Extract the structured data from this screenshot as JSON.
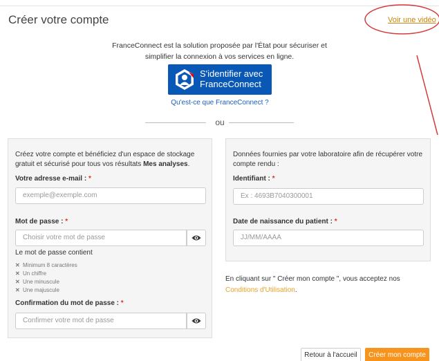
{
  "header": {
    "title": "Créer votre compte",
    "video_link": "Voir une vidéo"
  },
  "franceconnect": {
    "intro_line1": "FranceConnect est la solution proposée par l'État pour sécuriser et",
    "intro_line2": "simplifier la connexion à vos services en ligne.",
    "button_line1": "S'identifier avec",
    "button_line2": "FranceConnect",
    "what_link": "Qu'est-ce que FranceConnect ?",
    "brand_color": "#0a58b5"
  },
  "separator": {
    "text": "ou"
  },
  "account_form": {
    "intro_prefix": "Créez votre compte et bénéficiez d'un espace de stockage gratuit et sécurisé pour tous vos résultats ",
    "intro_bold": "Mes analyses",
    "intro_suffix": ".",
    "email_label": "Votre adresse e-mail : ",
    "email_placeholder": "exemple@exemple.com",
    "password_label": "Mot de passe : ",
    "password_placeholder": "Choisir votre mot de passe",
    "password_rules_title": "Le mot de passe contient",
    "password_rules": [
      "Minimum 8 caractères",
      "Un chiffre",
      "Une minuscule",
      "Une majuscule"
    ],
    "confirm_label": "Confirmation du mot de passe : ",
    "confirm_placeholder": "Confirmer votre mot de passe",
    "required_mark": "*"
  },
  "lab_form": {
    "intro": "Données fournies par votre laboratoire afin de récupérer votre compte rendu :",
    "id_label": "Identifiant : ",
    "id_placeholder": "Ex : 4693B7040300001",
    "dob_label": "Date de naissance du patient : ",
    "dob_placeholder": "JJ/MM/AAAA",
    "required_mark": "*"
  },
  "consent": {
    "text": "En cliquant sur \" Créer mon compte \", vous acceptez nos ",
    "terms_link": "Conditions d'Utilisation",
    "end": "."
  },
  "actions": {
    "home_label": "Retour à l'accueil",
    "create_label": "Créer mon compte",
    "accent_color": "#f7941d"
  }
}
